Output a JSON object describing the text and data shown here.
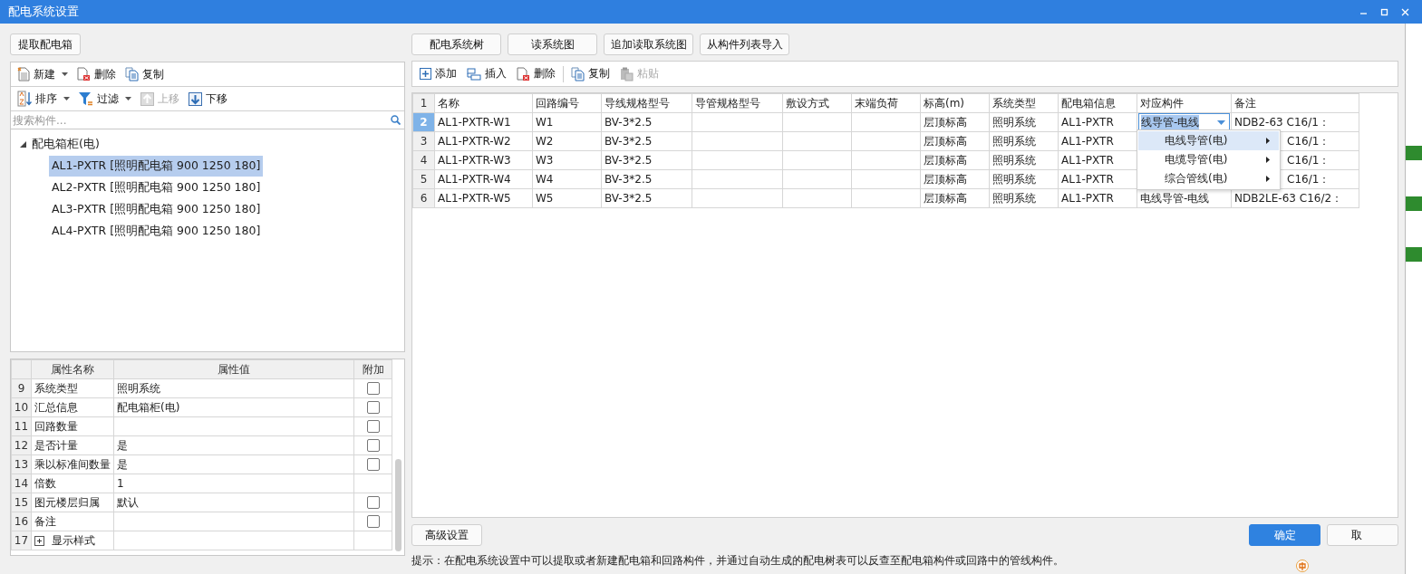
{
  "window": {
    "title": "配电系统设置"
  },
  "left_panel": {
    "extract_button": "提取配电箱",
    "toolbar_1": [
      {
        "label": "新建",
        "kind": "new",
        "dropdown": true,
        "disabled": false
      },
      {
        "label": "删除",
        "kind": "delete",
        "dropdown": false,
        "disabled": false
      },
      {
        "label": "复制",
        "kind": "copy",
        "dropdown": false,
        "disabled": false
      }
    ],
    "toolbar_2": [
      {
        "label": "排序",
        "kind": "sort",
        "dropdown": true,
        "disabled": false
      },
      {
        "label": "过滤",
        "kind": "filter",
        "dropdown": true,
        "disabled": false
      },
      {
        "label": "上移",
        "kind": "up",
        "dropdown": false,
        "disabled": true
      },
      {
        "label": "下移",
        "kind": "down",
        "dropdown": false,
        "disabled": false
      }
    ],
    "search": {
      "placeholder": "搜索构件..."
    },
    "tree": [
      {
        "label": "配电箱柜(电)",
        "expanded": true,
        "selected": false,
        "children": [
          {
            "label": "AL1-PXTR [照明配电箱 900 1250 180]",
            "selected": true
          },
          {
            "label": "AL2-PXTR [照明配电箱 900 1250 180]",
            "selected": false
          },
          {
            "label": "AL3-PXTR [照明配电箱 900 1250 180]",
            "selected": false
          },
          {
            "label": "AL4-PXTR [照明配电箱 900 1250 180]",
            "selected": false
          }
        ]
      }
    ],
    "properties": {
      "columns": [
        "属性名称",
        "属性值",
        "附加"
      ],
      "rows": [
        {
          "index": "9",
          "name": "系统类型",
          "value": "照明系统",
          "kind": "checkbox",
          "checked": false
        },
        {
          "index": "10",
          "name": "汇总信息",
          "value": "配电箱柜(电)",
          "kind": "checkbox",
          "checked": false
        },
        {
          "index": "11",
          "name": "回路数量",
          "kind": "checkbox",
          "checked": false
        },
        {
          "index": "12",
          "name": "是否计量",
          "value": "是",
          "kind": "checkbox",
          "checked": false
        },
        {
          "index": "13",
          "name": "乘以标准间数量",
          "value": "是",
          "kind": "checkbox",
          "checked": false
        },
        {
          "index": "14",
          "name": "倍数",
          "value": "1",
          "kind": "plain"
        },
        {
          "index": "15",
          "name": "图元楼层归属",
          "value": "默认",
          "kind": "checkbox",
          "checked": false
        },
        {
          "index": "16",
          "name": "备注",
          "kind": "checkbox",
          "checked": false
        },
        {
          "index": "17",
          "name": "显示样式",
          "kind": "group",
          "expanded": false
        }
      ]
    }
  },
  "right_panel": {
    "buttons": [
      "配电系统树",
      "读系统图",
      "追加读取系统图",
      "从构件列表导入"
    ],
    "toolbar": [
      {
        "label": "添加",
        "kind": "add",
        "disabled": false
      },
      {
        "label": "插入",
        "kind": "insert",
        "disabled": false
      },
      {
        "label": "删除",
        "kind": "delete",
        "disabled": false
      },
      {
        "label": "复制",
        "kind": "copy",
        "disabled": false
      },
      {
        "label": "粘贴",
        "kind": "paste",
        "disabled": true
      }
    ],
    "table": {
      "header_index": "1",
      "columns": [
        "名称",
        "回路编号",
        "导线规格型号",
        "导管规格型号",
        "敷设方式",
        "末端负荷",
        "标高(m)",
        "系统类型",
        "配电箱信息",
        "对应构件",
        "备注"
      ],
      "rows": [
        {
          "index": "2",
          "selected": true,
          "editing": true,
          "cells": [
            "AL1-PXTR-W1",
            "W1",
            "BV-3*2.5",
            null,
            null,
            null,
            "层顶标高",
            "照明系统",
            "AL1-PXTR",
            "线导管-电线",
            "NDB2-63 C16/1："
          ]
        },
        {
          "index": "3",
          "selected": false,
          "editing": false,
          "cells": [
            "AL1-PXTR-W2",
            "W2",
            "BV-3*2.5",
            null,
            null,
            null,
            "层顶标高",
            "照明系统",
            "AL1-PXTR",
            null,
            "C16/1："
          ]
        },
        {
          "index": "4",
          "selected": false,
          "editing": false,
          "cells": [
            "AL1-PXTR-W3",
            "W3",
            "BV-3*2.5",
            null,
            null,
            null,
            "层顶标高",
            "照明系统",
            "AL1-PXTR",
            null,
            "C16/1："
          ]
        },
        {
          "index": "5",
          "selected": false,
          "editing": false,
          "cells": [
            "AL1-PXTR-W4",
            "W4",
            "BV-3*2.5",
            null,
            null,
            null,
            "层顶标高",
            "照明系统",
            "AL1-PXTR",
            null,
            "C16/1："
          ]
        },
        {
          "index": "6",
          "selected": false,
          "editing": false,
          "cells": [
            "AL1-PXTR-W5",
            "W5",
            "BV-3*2.5",
            null,
            null,
            null,
            "层顶标高",
            "照明系统",
            "AL1-PXTR",
            "电线导管-电线",
            "NDB2LE-63 C16/2："
          ]
        }
      ]
    },
    "dropdown_menu": [
      {
        "label": "电线导管(电)",
        "selected": true
      },
      {
        "label": "电缆导管(电)",
        "selected": false
      },
      {
        "label": "综合管线(电)",
        "selected": false
      }
    ]
  },
  "footer": {
    "advanced_button": "高级设置",
    "ok_button": "确定",
    "cancel_button": "取",
    "hint": "提示：在配电系统设置中可以提取或者新建配电箱和回路构件，并通过自动生成的配电树表可以反查至配电箱构件或回路中的管线构件。"
  }
}
